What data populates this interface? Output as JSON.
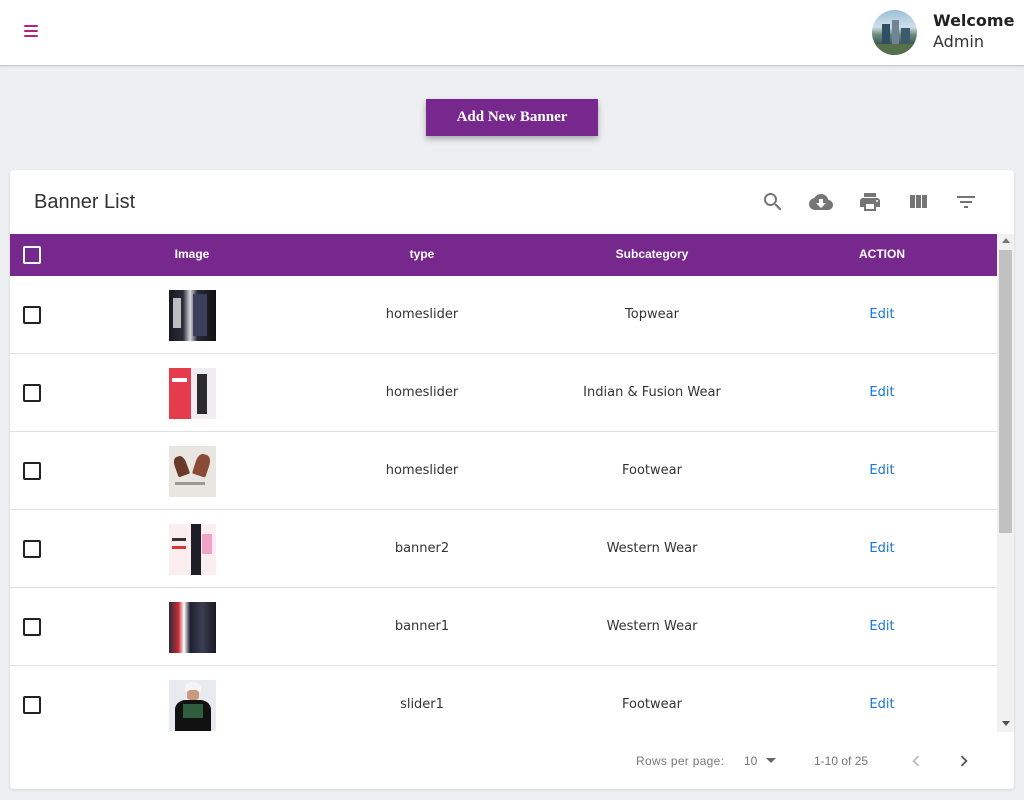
{
  "header": {
    "greeting": "Welcome",
    "user": "Admin"
  },
  "actions": {
    "add_banner": "Add New Banner"
  },
  "card": {
    "title": "Banner List",
    "toolbar_icons": [
      "search-icon",
      "cloud-download-icon",
      "print-icon",
      "view-columns-icon",
      "filter-list-icon"
    ]
  },
  "table": {
    "columns": [
      "Image",
      "type",
      "Subcategory",
      "ACTION"
    ],
    "rows": [
      {
        "type": "homeslider",
        "subcategory": "Topwear",
        "action": "Edit"
      },
      {
        "type": "homeslider",
        "subcategory": "Indian & Fusion Wear",
        "action": "Edit"
      },
      {
        "type": "homeslider",
        "subcategory": "Footwear",
        "action": "Edit"
      },
      {
        "type": "banner2",
        "subcategory": "Western Wear",
        "action": "Edit"
      },
      {
        "type": "banner1",
        "subcategory": "Western Wear",
        "action": "Edit"
      },
      {
        "type": "slider1",
        "subcategory": "Footwear",
        "action": "Edit"
      }
    ]
  },
  "pagination": {
    "rows_per_page_label": "Rows per page:",
    "rows_per_page": "10",
    "range": "1-10 of 25"
  },
  "colors": {
    "primary": "#76288c",
    "menu_icon": "#b0267f",
    "link": "#1976d2"
  }
}
